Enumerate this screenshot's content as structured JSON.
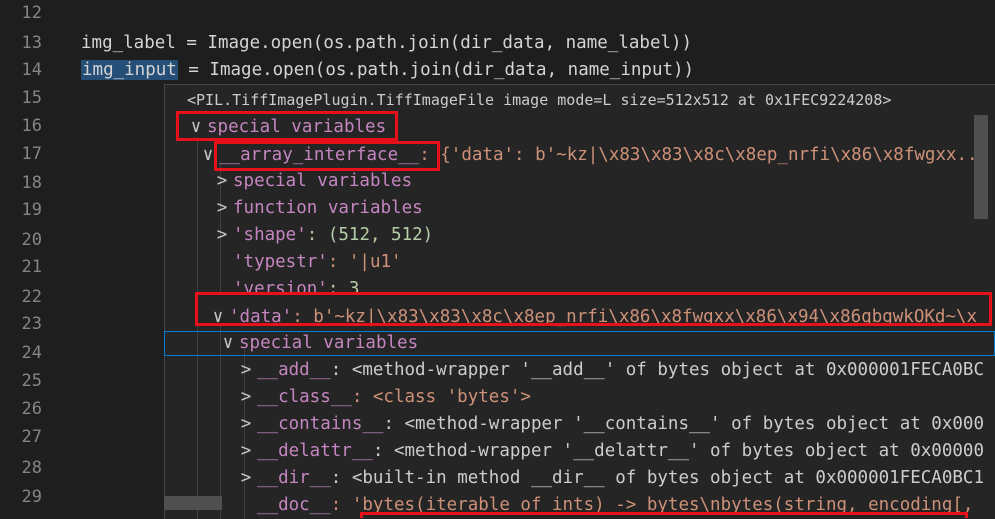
{
  "editor": {
    "lines": [
      {
        "num": "12",
        "text": ""
      },
      {
        "num": "13",
        "text": "img_label = Image.open(os.path.join(dir_data, name_label))"
      },
      {
        "num": "14",
        "text_var": "img_input",
        "text": " = Image.open(os.path.join(dir_data, name_input))"
      },
      {
        "num": "15"
      },
      {
        "num": "16"
      },
      {
        "num": "17"
      },
      {
        "num": "18"
      },
      {
        "num": "19"
      },
      {
        "num": "20"
      },
      {
        "num": "21"
      },
      {
        "num": "22"
      },
      {
        "num": "23"
      },
      {
        "num": "24"
      },
      {
        "num": "25"
      },
      {
        "num": "26"
      },
      {
        "num": "27"
      },
      {
        "num": "28"
      },
      {
        "num": "29"
      }
    ]
  },
  "hover": {
    "header": "<PIL.TiffImagePlugin.TiffImageFile image mode=L size=512x512 at 0x1FEC9224208>",
    "tree": [
      {
        "label": "special variables",
        "value": "",
        "chev": "∨"
      },
      {
        "label": "__array_interface__",
        "value": ": {'data': b'~kz|\\x83\\x83\\x8c\\x8ep_nrfi\\x86\\x8fwgxx...",
        "chev": "∨"
      },
      {
        "label": "special variables",
        "value": "",
        "chev": ">"
      },
      {
        "label": "function variables",
        "value": "",
        "chev": ">"
      },
      {
        "label": "'shape'",
        "value": ": (512, 512)",
        "chev": ">"
      },
      {
        "label": "'typestr'",
        "value": ": '|u1'",
        "chev": ""
      },
      {
        "label": "'version'",
        "value": ": 3",
        "chev": ""
      },
      {
        "label": "'data'",
        "value": ": b'~kz|\\x83\\x83\\x8c\\x8ep_nrfi\\x86\\x8fwgxx\\x86\\x94\\x86qbgwkOKd~\\x",
        "chev": "∨"
      },
      {
        "label": "special variables",
        "value": "",
        "chev": "∨"
      },
      {
        "label": "__add__",
        "value": ": <method-wrapper '__add__' of bytes object at 0x000001FECA0BC",
        "chev": ">"
      },
      {
        "label": "__class__",
        "value": ": <class 'bytes'>",
        "chev": ">"
      },
      {
        "label": "__contains__",
        "value": ": <method-wrapper '__contains__' of bytes object at 0x000",
        "chev": ">"
      },
      {
        "label": "__delattr__",
        "value": ": <method-wrapper '__delattr__' of bytes object at 0x00000",
        "chev": ">"
      },
      {
        "label": "__dir__",
        "value": ": <built-in method __dir__ of bytes object at 0x000001FECA0BC1",
        "chev": ">"
      },
      {
        "label": "__doc__",
        "value": ": 'bytes(iterable_of_ints) -> bytes\\nbytes(string, encoding[,",
        "chev": ""
      }
    ]
  },
  "colors": {
    "annotation": "#e6111a",
    "keyword": "#c586c0",
    "string": "#ce9178",
    "number": "#b5cea8"
  }
}
